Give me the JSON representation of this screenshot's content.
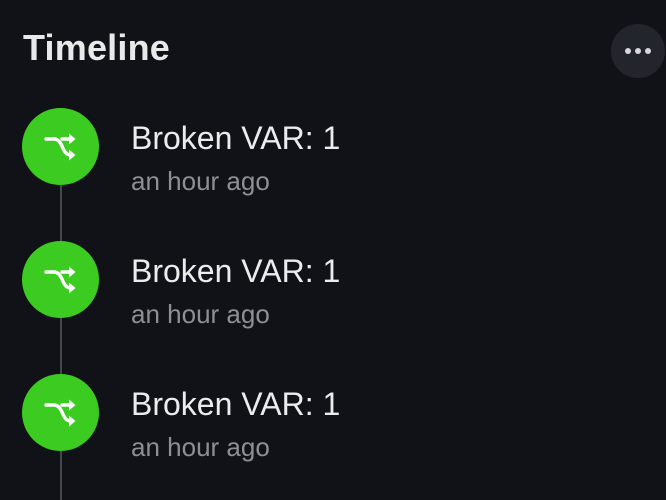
{
  "header": {
    "title": "Timeline",
    "more_icon": "more-horizontal-icon"
  },
  "timeline": {
    "entries": [
      {
        "icon": "shuffle-icon",
        "title": "Broken VAR: 1",
        "time": "an hour ago"
      },
      {
        "icon": "shuffle-icon",
        "title": "Broken VAR: 1",
        "time": "an hour ago"
      },
      {
        "icon": "shuffle-icon",
        "title": "Broken VAR: 1",
        "time": "an hour ago"
      }
    ]
  },
  "colors": {
    "background": "#111217",
    "accent_green": "#3ccb20",
    "timeline_line": "#45474e"
  }
}
